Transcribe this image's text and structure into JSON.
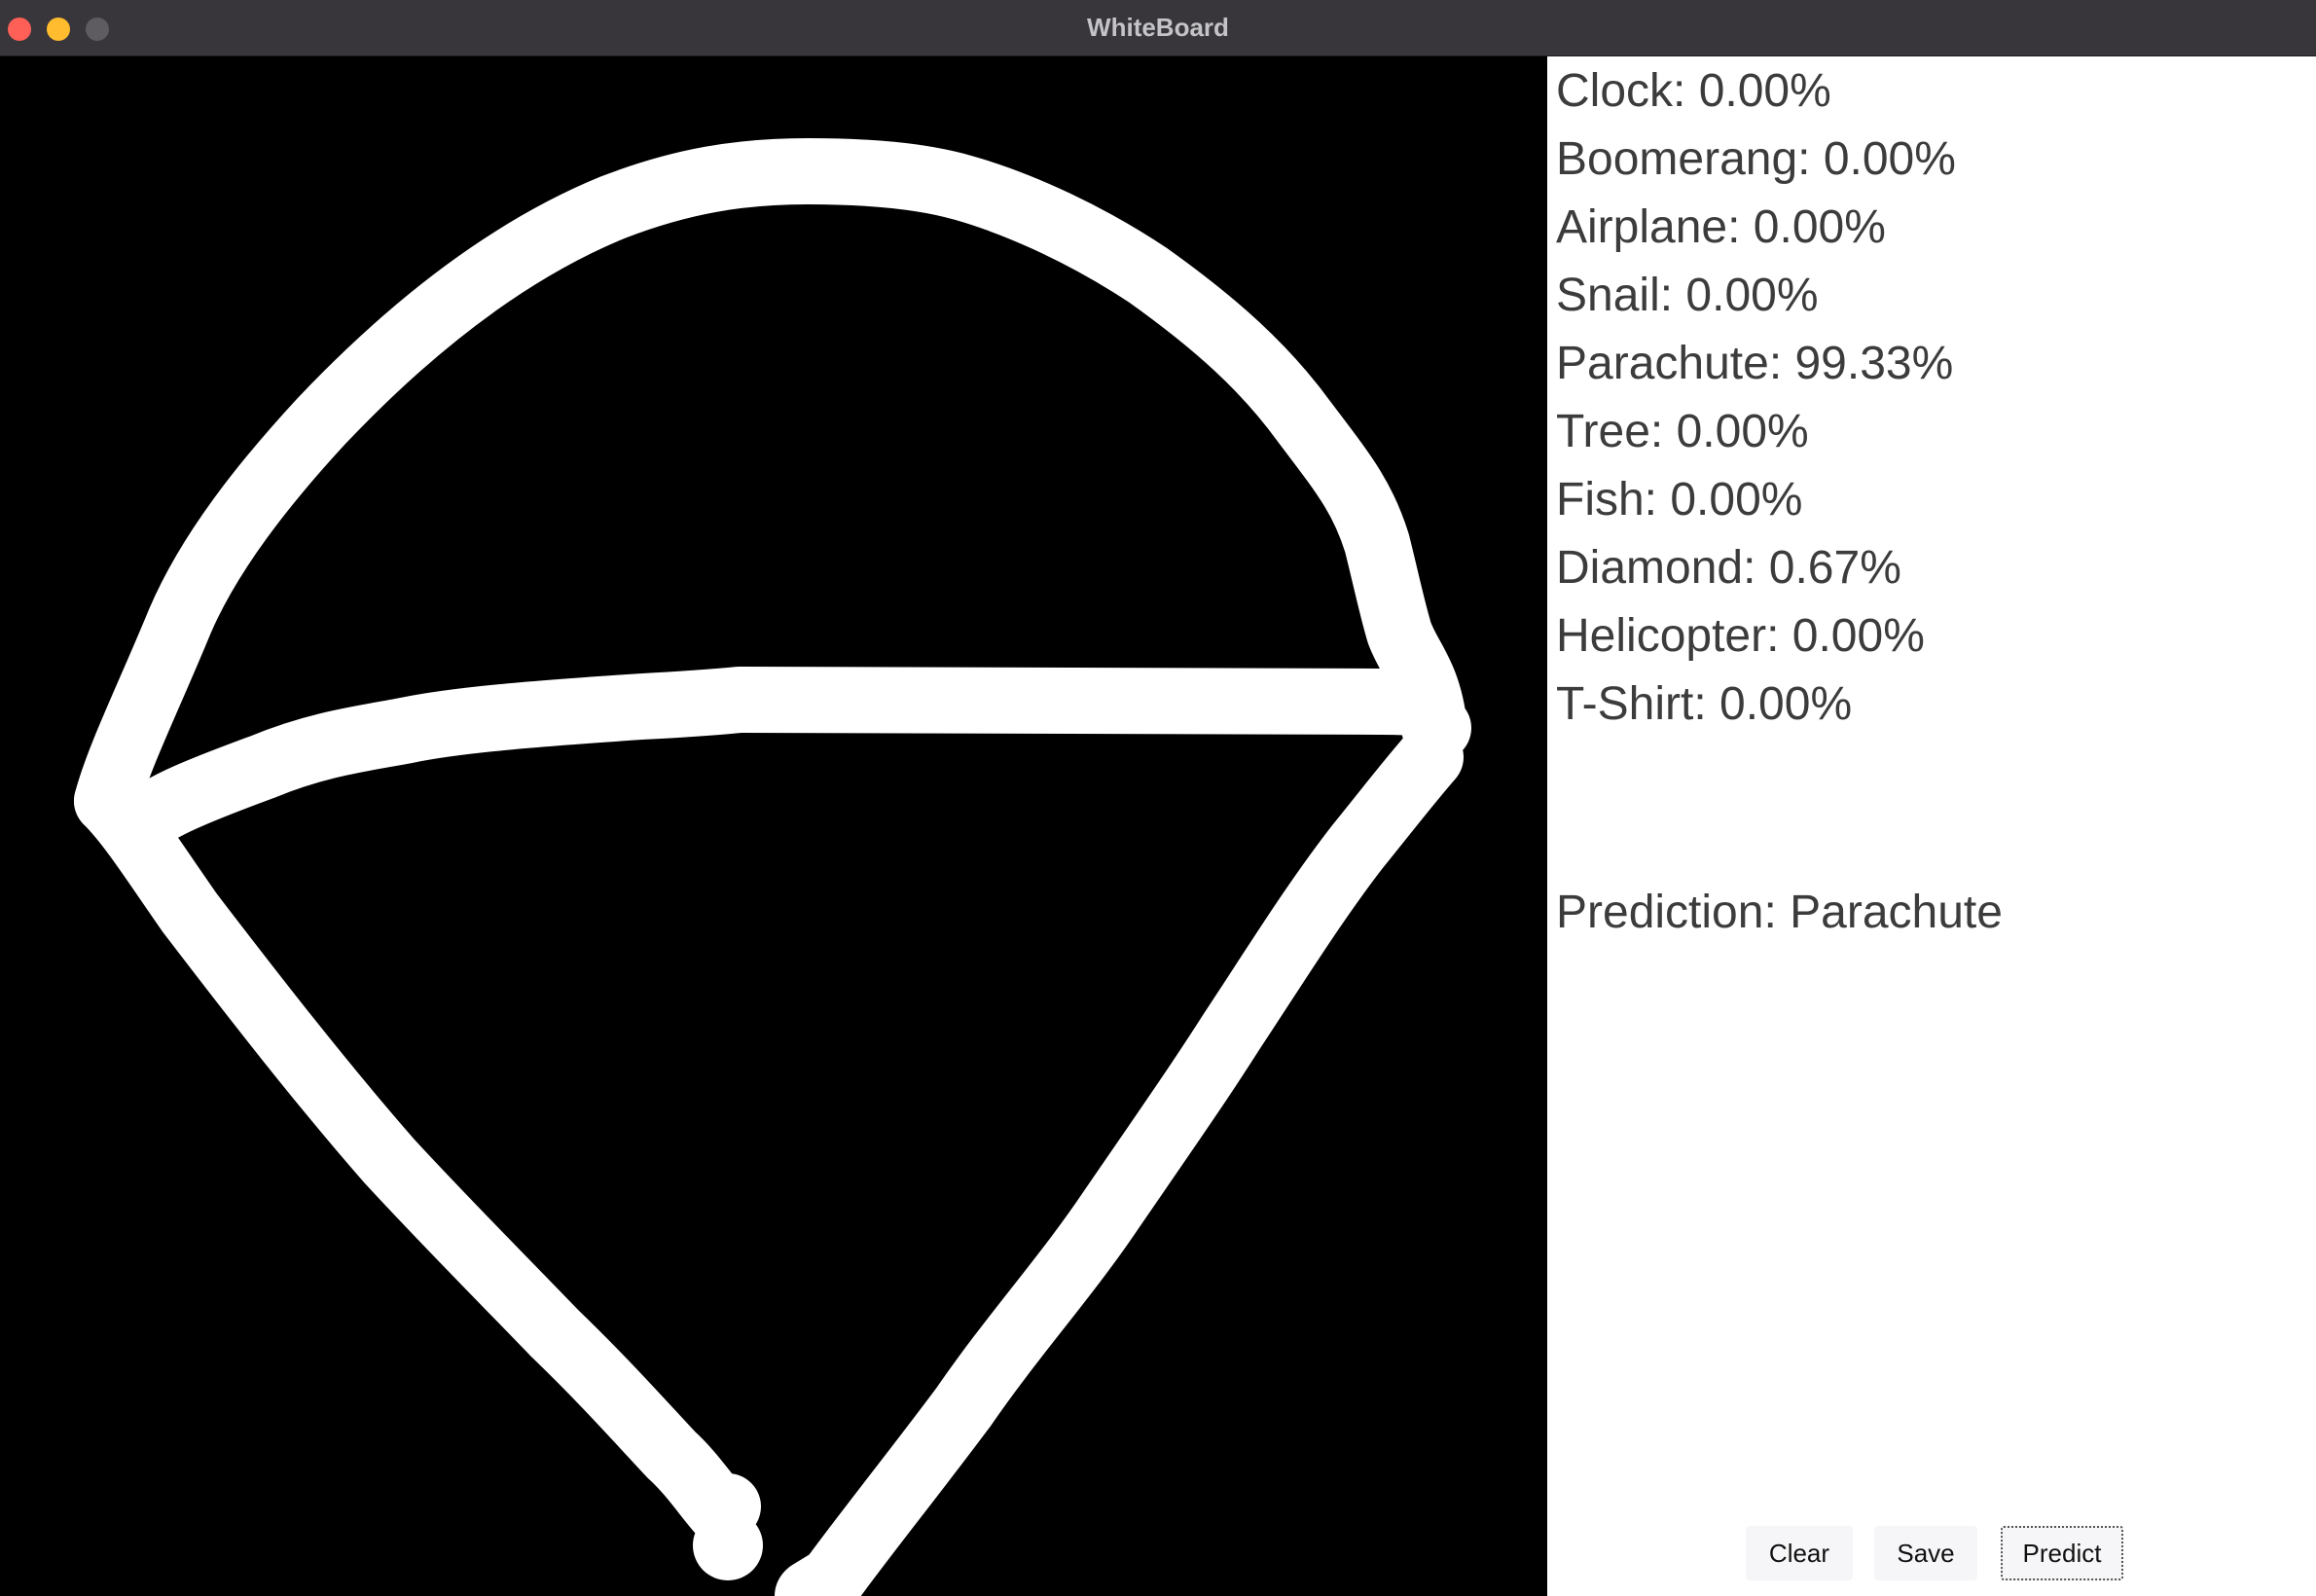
{
  "window": {
    "title": "WhiteBoard"
  },
  "probabilities": [
    {
      "label": "Clock",
      "text": "Clock: 0.00%",
      "value": 0.0
    },
    {
      "label": "Boomerang",
      "text": "Boomerang: 0.00%",
      "value": 0.0
    },
    {
      "label": "Airplane",
      "text": "Airplane: 0.00%",
      "value": 0.0
    },
    {
      "label": "Snail",
      "text": "Snail: 0.00%",
      "value": 0.0
    },
    {
      "label": "Parachute",
      "text": "Parachute: 99.33%",
      "value": 99.33
    },
    {
      "label": "Tree",
      "text": "Tree: 0.00%",
      "value": 0.0
    },
    {
      "label": "Fish",
      "text": "Fish: 0.00%",
      "value": 0.0
    },
    {
      "label": "Diamond",
      "text": "Diamond: 0.67%",
      "value": 0.67
    },
    {
      "label": "Helicopter",
      "text": "Helicopter: 0.00%",
      "value": 0.0
    },
    {
      "label": "T-Shirt",
      "text": "T-Shirt: 0.00%",
      "value": 0.0
    }
  ],
  "prediction": {
    "text": "Prediction: Parachute"
  },
  "buttons": {
    "clear": "Clear",
    "save": "Save",
    "predict": "Predict"
  },
  "colors": {
    "canvas_background": "#000000",
    "stroke": "#ffffff",
    "titlebar": "#38363b",
    "close": "#fe5f57",
    "minimize": "#febc2e",
    "maximize": "#5e5c61"
  }
}
